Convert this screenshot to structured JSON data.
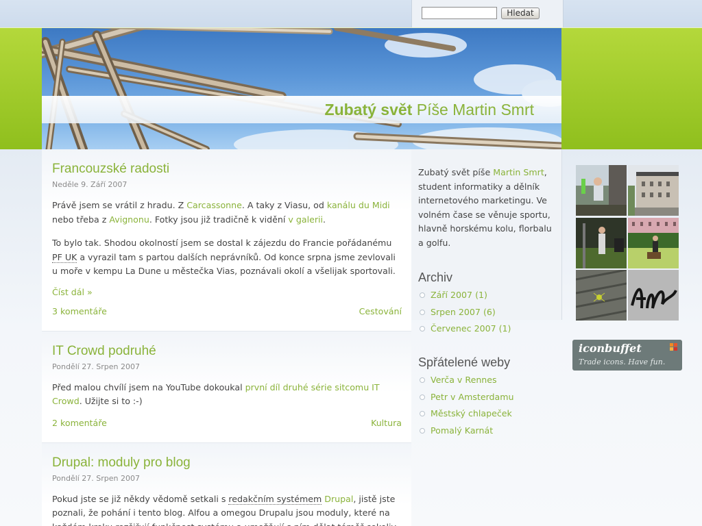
{
  "search": {
    "placeholder": "",
    "value": "",
    "button_label": "Hledat"
  },
  "site": {
    "title_bold": "Zubatý svět",
    "subtitle": "Píše Martin Smrt"
  },
  "posts": [
    {
      "title": "Francouzské radosti",
      "date": "Neděle 9. Září 2007",
      "p1_a": "Právě jsem se vrátil z hradu. Z ",
      "p1_link1": "Carcassonne",
      "p1_b": ". A taky z Viasu, od ",
      "p1_link2": "kanálu du Midi",
      "p1_c": " nebo třeba z ",
      "p1_link3": "Avignonu",
      "p1_d": ". Fotky jsou již tradičně k vidění ",
      "p1_link4": "v galerii",
      "p1_e": ".",
      "p2_a": "To bylo tak. Shodou okolností jsem se dostal k zájezdu do Francie pořádanému ",
      "p2_abbr": "PF UK",
      "p2_b": " a vyrazil tam s partou dalších neprávníků. Od konce srpna jsme zevlovali u moře v kempu La Dune u městečka Vias, poznávali okolí a všelijak sportovali.",
      "read_more": "Číst dál »",
      "comments": "3 komentáře",
      "category": "Cestování"
    },
    {
      "title": "IT Crowd podruhé",
      "date": "Pondělí 27. Srpen 2007",
      "p1_a": "Před malou chvílí jsem na YouTube dokoukal ",
      "p1_link1": "první díl druhé série sitcomu IT Crowd",
      "p1_b": ". Užijte si to :-)",
      "comments": "2 komentáře",
      "category": "Kultura"
    },
    {
      "title": "Drupal: moduly pro blog",
      "date": "Pondělí 27. Srpen 2007",
      "p1_a": "Pokud jste se již někdy vědomě setkali s ",
      "p1_abbr": "redakčním systémem",
      "p1_b": " ",
      "p1_link1": "Drupal",
      "p1_c": ", jistě jste poznali, že pohání i tento blog. Alfou a omegou Drupalu jsou moduly, které na každém kroku rozšiřují funkčnost systému a umožňují s ním dělat téměř cokoliv."
    }
  ],
  "sidebar": {
    "about_a": "Zubatý svět píše ",
    "about_link": "Martin Smrt",
    "about_b": ", student informatiky a dělník internetového marketingu. Ve volném čase se věnuje sportu, hlavně horskému kolu, florbalu a golfu.",
    "archive_title": "Archiv",
    "archive": [
      "Září 2007 (1)",
      "Srpen 2007 (6)",
      "Červenec 2007 (1)"
    ],
    "friends_title": "Spřátelené weby",
    "friends": [
      "Verča v Rennes",
      "Petr v Amsterdamu",
      "Městský chlapeček",
      "Pomalý Karnát"
    ]
  },
  "iconbuffet": {
    "title": "iconbuffet",
    "tagline": "Trade icons. Have fun."
  },
  "colors": {
    "accent": "#8ab33a",
    "green_band": "#a6d12e",
    "sky": "#5b96d8",
    "page_bg": "#d3dfee"
  }
}
